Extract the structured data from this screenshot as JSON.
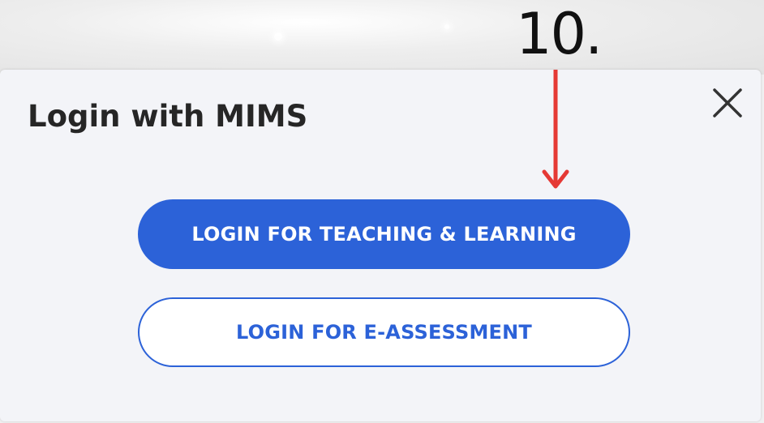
{
  "annotation": {
    "label": "10.",
    "arrow_color": "#e53935"
  },
  "dialog": {
    "title": "Login with MIMS",
    "close_icon": "close-icon"
  },
  "buttons": {
    "teaching_learning": "LOGIN FOR TEACHING & LEARNING",
    "e_assessment": "LOGIN FOR E-ASSESSMENT"
  },
  "colors": {
    "accent": "#2c62d8",
    "dialog_bg": "#f3f4f8",
    "title_text": "#262626"
  }
}
